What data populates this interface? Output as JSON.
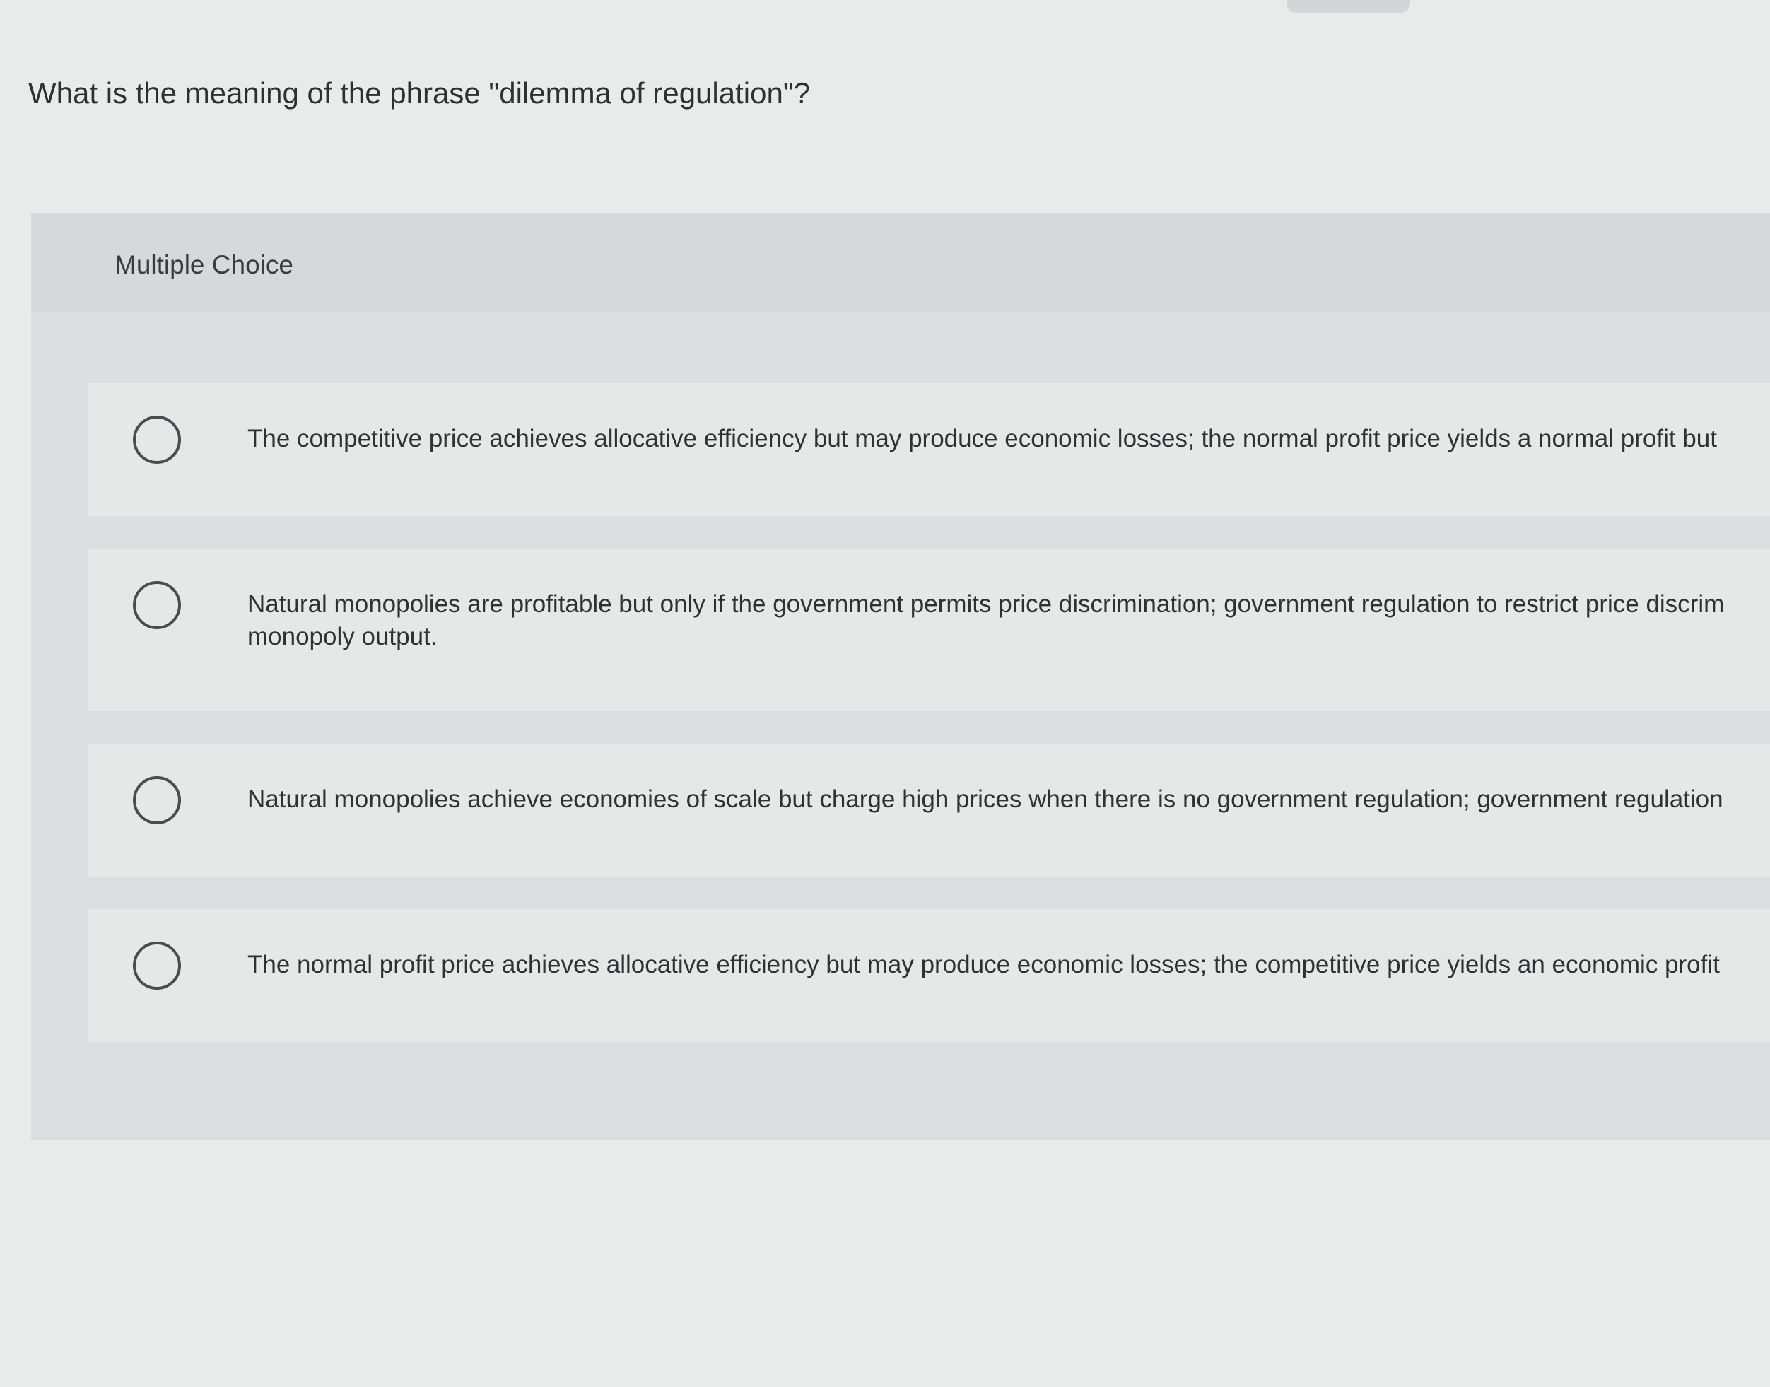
{
  "question": {
    "text": "What is the meaning of the phrase \"dilemma of regulation\"?"
  },
  "multiple_choice": {
    "label": "Multiple Choice",
    "options": [
      {
        "text": "The competitive price achieves allocative efficiency but may produce economic losses; the normal profit price yields a normal profit but",
        "selected": false
      },
      {
        "text": "Natural monopolies are profitable but only if the government permits price discrimination; government regulation to restrict price discrim monopoly output.",
        "selected": false
      },
      {
        "text": "Natural monopolies achieve economies of scale but charge high prices when there is no government regulation; government regulation",
        "selected": false
      },
      {
        "text": "The normal profit price achieves allocative efficiency but may produce economic losses; the competitive price yields an economic profit",
        "selected": false
      }
    ]
  }
}
